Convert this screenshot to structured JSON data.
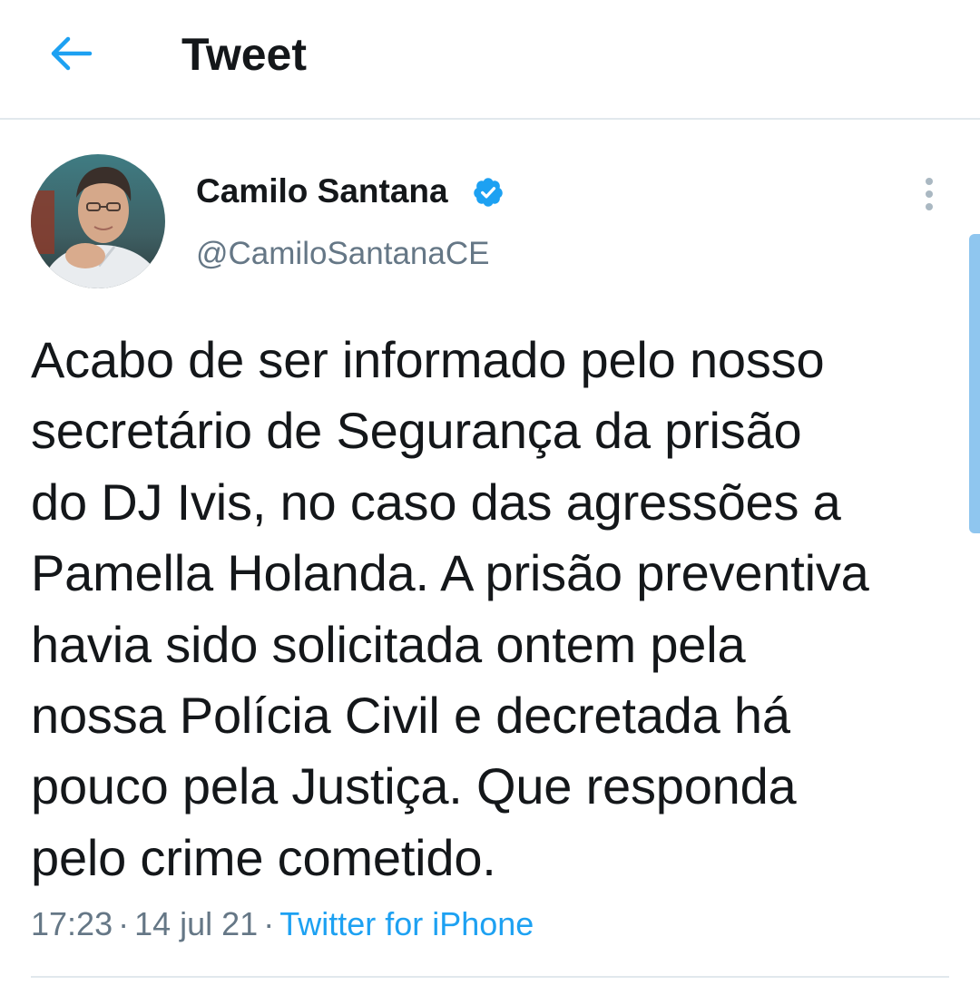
{
  "header": {
    "title": "Tweet",
    "back_icon": "arrow-left-icon",
    "accent_color": "#1da1f2"
  },
  "tweet": {
    "author": {
      "name": "Camilo Santana",
      "handle": "@CamiloSantanaCE",
      "verified": true,
      "verified_icon": "verified-badge-icon"
    },
    "text": "Acabo de ser informado pelo nosso\nsecretário de Segurança da prisão\ndo DJ Ivis, no caso das agressões a\nPamella Holanda. A prisão preventiva\nhavia sido solicitada ontem pela\nnossa Polícia Civil e decretada há\npouco pela Justiça. Que responda\npelo crime cometido.",
    "time": "17:23",
    "date": "14 jul 21",
    "source": "Twitter for iPhone",
    "separator": "·",
    "more_icon": "more-vertical-icon"
  }
}
